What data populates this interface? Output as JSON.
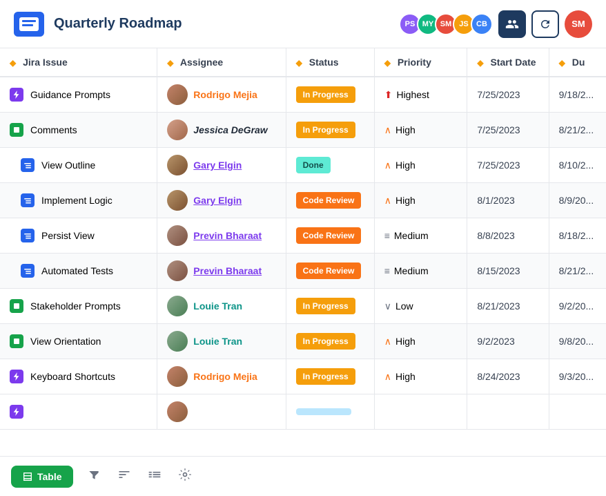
{
  "header": {
    "title": "Quarterly Roadmap",
    "avatars": [
      {
        "initials": "PS",
        "color": "#8b5cf6",
        "key": "ps"
      },
      {
        "initials": "MY",
        "color": "#10b981",
        "key": "my"
      },
      {
        "initials": "SM",
        "color": "#e74c3c",
        "key": "sm"
      },
      {
        "initials": "JS",
        "color": "#f59e0b",
        "key": "js"
      },
      {
        "initials": "CB",
        "color": "#3b82f6",
        "key": "cb"
      }
    ],
    "current_user": "SM"
  },
  "table": {
    "columns": [
      "Jira Issue",
      "Assignee",
      "Status",
      "Priority",
      "Start Date",
      "Du"
    ],
    "rows": [
      {
        "issue": "Guidance Prompts",
        "issue_type": "lightning",
        "issue_color": "purple",
        "assignee": "Rodrigo Mejia",
        "assignee_style": "orange",
        "assignee_avatar": "rodrigo",
        "status": "In Progress",
        "status_type": "in-progress",
        "priority": "Highest",
        "priority_icon": "highest",
        "start_date": "7/25/2023",
        "due_date": "9/18/2..."
      },
      {
        "issue": "Comments",
        "issue_type": "square",
        "issue_color": "green",
        "assignee": "Jessica DeGraw",
        "assignee_style": "italic-bold",
        "assignee_avatar": "jessica",
        "status": "In Progress",
        "status_type": "in-progress",
        "priority": "High",
        "priority_icon": "high",
        "start_date": "7/25/2023",
        "due_date": "8/21/2..."
      },
      {
        "issue": "View Outline",
        "issue_type": "sub",
        "issue_color": "blue",
        "assignee": "Gary Elgin",
        "assignee_style": "purple-underline",
        "assignee_avatar": "gary",
        "status": "Done",
        "status_type": "done",
        "priority": "High",
        "priority_icon": "high",
        "start_date": "7/25/2023",
        "due_date": "8/10/2..."
      },
      {
        "issue": "Implement Logic",
        "issue_type": "sub",
        "issue_color": "blue",
        "assignee": "Gary Elgin",
        "assignee_style": "purple-underline",
        "assignee_avatar": "gary",
        "status": "Code Review",
        "status_type": "code-review",
        "priority": "High",
        "priority_icon": "high",
        "start_date": "8/1/2023",
        "due_date": "8/9/20..."
      },
      {
        "issue": "Persist View",
        "issue_type": "sub",
        "issue_color": "blue",
        "assignee": "Previn Bharaat",
        "assignee_style": "purple-underline",
        "assignee_avatar": "previn",
        "status": "Code Review",
        "status_type": "code-review",
        "priority": "Medium",
        "priority_icon": "medium",
        "start_date": "8/8/2023",
        "due_date": "8/18/2..."
      },
      {
        "issue": "Automated Tests",
        "issue_type": "sub",
        "issue_color": "blue",
        "assignee": "Previn Bharaat",
        "assignee_style": "purple-underline",
        "assignee_avatar": "previn",
        "status": "Code Review",
        "status_type": "code-review",
        "priority": "Medium",
        "priority_icon": "medium",
        "start_date": "8/15/2023",
        "due_date": "8/21/2..."
      },
      {
        "issue": "Stakeholder Prompts",
        "issue_type": "square",
        "issue_color": "green",
        "assignee": "Louie Tran",
        "assignee_style": "teal",
        "assignee_avatar": "louie",
        "status": "In Progress",
        "status_type": "in-progress",
        "priority": "Low",
        "priority_icon": "low",
        "start_date": "8/21/2023",
        "due_date": "9/2/20..."
      },
      {
        "issue": "View Orientation",
        "issue_type": "square",
        "issue_color": "green",
        "assignee": "Louie Tran",
        "assignee_style": "teal",
        "assignee_avatar": "louie",
        "status": "In Progress",
        "status_type": "in-progress",
        "priority": "High",
        "priority_icon": "high",
        "start_date": "9/2/2023",
        "due_date": "9/8/20..."
      },
      {
        "issue": "Keyboard Shortcuts",
        "issue_type": "lightning",
        "issue_color": "purple",
        "assignee": "Rodrigo Mejia",
        "assignee_style": "orange",
        "assignee_avatar": "rodrigo",
        "status": "In Progress",
        "status_type": "in-progress",
        "priority": "High",
        "priority_icon": "high",
        "start_date": "8/24/2023",
        "due_date": "9/3/20..."
      }
    ]
  },
  "toolbar": {
    "table_label": "Table",
    "icons": [
      "filter-icon",
      "sort-icon",
      "group-icon",
      "settings-icon"
    ]
  }
}
